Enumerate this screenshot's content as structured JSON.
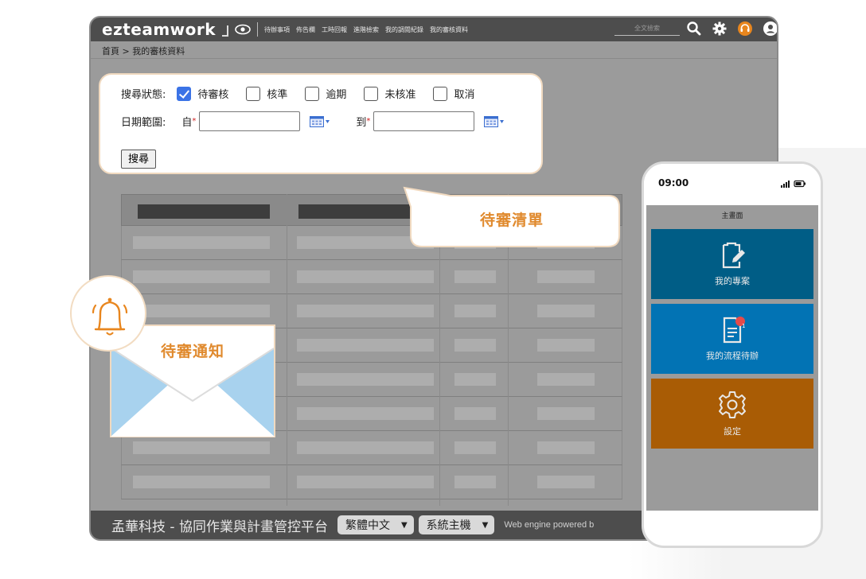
{
  "app": {
    "logo": "ezteamwork",
    "nav": [
      "待辦事項",
      "佈告欄",
      "工時回報",
      "進階檢索",
      "我的調閱紀錄",
      "我的審核資料"
    ],
    "search_placeholder": "全文檢索",
    "breadcrumb": "首頁 > 我的審核資料"
  },
  "search_form": {
    "status_label": "搜尋狀態:",
    "statuses": [
      {
        "label": "待審核",
        "checked": true
      },
      {
        "label": "核準",
        "checked": false
      },
      {
        "label": "逾期",
        "checked": false
      },
      {
        "label": "未核准",
        "checked": false
      },
      {
        "label": "取消",
        "checked": false
      }
    ],
    "date_label": "日期範圍:",
    "from_label": "自",
    "to_label": "到",
    "required_mark": "*",
    "search_button": "搜尋"
  },
  "callouts": {
    "pending_list": "待審清單",
    "pending_notice": "待審通知",
    "accent": "#e08a2e"
  },
  "footer": {
    "title": "孟華科技 - 協同作業與計畫管控平台",
    "language": "繁體中文",
    "host": "系統主機",
    "engine": "Web engine powered b"
  },
  "phone": {
    "time": "09:00",
    "header": "主畫面",
    "badge": "1",
    "tiles": [
      {
        "label": "我的專案",
        "icon": "clipboard-edit-icon",
        "color": "#005d86"
      },
      {
        "label": "我的流程待辦",
        "icon": "document-list-icon",
        "color": "#0273b4"
      },
      {
        "label": "設定",
        "icon": "gear-icon",
        "color": "#a95c05"
      }
    ]
  }
}
